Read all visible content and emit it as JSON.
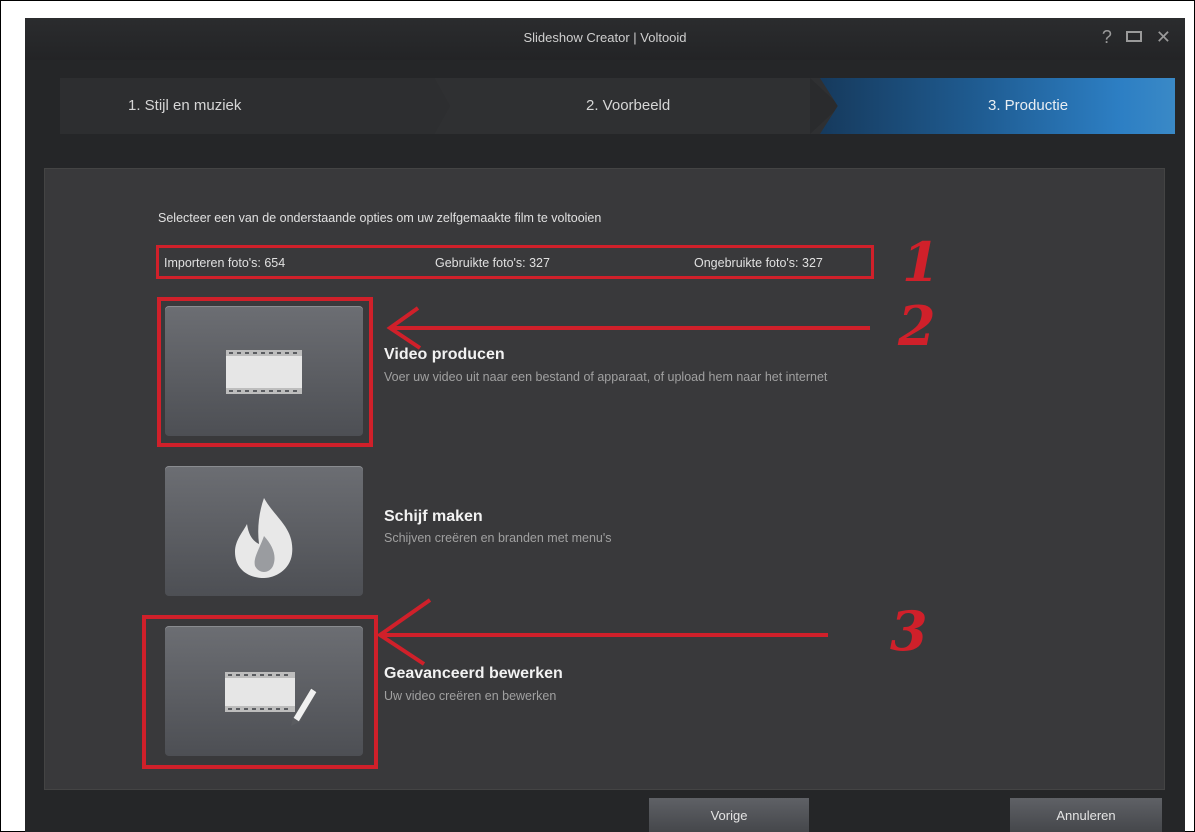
{
  "window": {
    "title": "Slideshow Creator | Voltooid",
    "controls": {
      "help": "?",
      "close": "✕"
    }
  },
  "steps": [
    {
      "label": "1. Stijl en muziek",
      "active": false
    },
    {
      "label": "2. Voorbeeld",
      "active": false
    },
    {
      "label": "3. Productie",
      "active": true
    }
  ],
  "main": {
    "intro": "Selecteer een van de onderstaande opties om uw zelfgemaakte film te voltooien",
    "stats": {
      "imported": "Importeren foto's: 654",
      "used": "Gebruikte foto's: 327",
      "unused": "Ongebruikte foto's: 327"
    },
    "options": [
      {
        "title": "Video producen",
        "description": "Voer uw video uit naar een bestand of apparaat, of upload hem naar het internet",
        "icon": "film-strip-icon"
      },
      {
        "title": "Schijf maken",
        "description": "Schijven creëren en branden met menu's",
        "icon": "flame-icon"
      },
      {
        "title": "Geavanceerd bewerken",
        "description": "Uw video creëren en bewerken",
        "icon": "film-edit-icon"
      }
    ]
  },
  "footer": {
    "previous": "Vorige",
    "cancel": "Annuleren"
  },
  "annotations": [
    "1",
    "2",
    "3"
  ],
  "colors": {
    "annotation_red": "#d0202a",
    "active_step": "#2d7fc4",
    "background": "#252628"
  }
}
